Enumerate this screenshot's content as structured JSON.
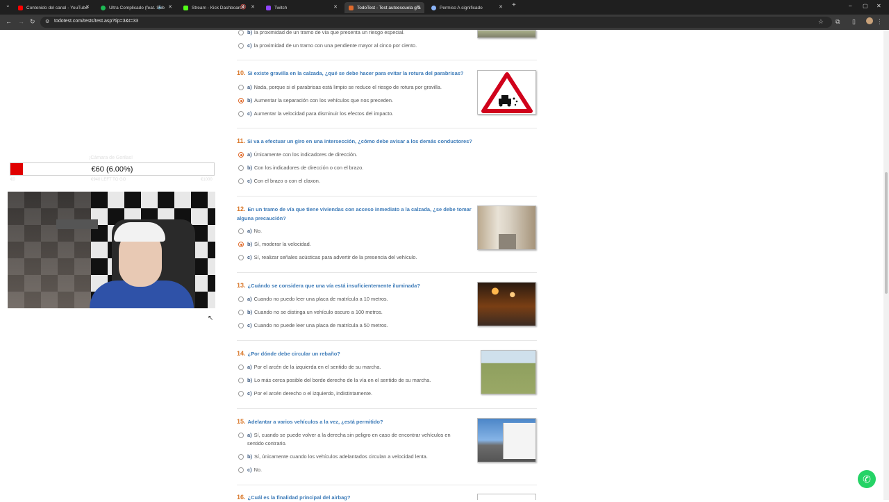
{
  "browser": {
    "tabs": [
      {
        "title": "Contenido del canal - YouTube",
        "color": "#ff0000",
        "active": false
      },
      {
        "title": "Ultra Complicado (feat. Seb",
        "color": "#1db954",
        "active": false
      },
      {
        "title": "Stream - Kick Dashboard",
        "color": "#53fc18",
        "active": false
      },
      {
        "title": "Twitch",
        "color": "#9146ff",
        "active": false
      },
      {
        "title": "TodoTest - Test autoescuela gra",
        "color": "#e06a2b",
        "active": true
      },
      {
        "title": "Permiso A significado",
        "color": "#8ab4f8",
        "active": false
      }
    ],
    "url": "todotest.com/tests/test.asp?tip=3&t=33"
  },
  "overlay": {
    "goal_label": "¡Cámara de Gorilas!",
    "goal_text": "€60 (6.00%)",
    "goal_progress": 0.06,
    "goal_min": "€0",
    "goal_togo": "€940 LEFT TO GO",
    "goal_max": "€1000"
  },
  "questions": [
    {
      "number": "",
      "title": "",
      "options": [
        {
          "letter": "b)",
          "text": "la proximidad de un tramo de vía que presenta un riesgo especial.",
          "selected": false
        },
        {
          "letter": "c)",
          "text": "la proximidad de un tramo con una pendiente mayor al cinco por ciento.",
          "selected": false
        }
      ]
    },
    {
      "number": "10.",
      "title": "Si existe gravilla en la calzada, ¿qué se debe hacer para evitar la rotura del parabrisas?",
      "options": [
        {
          "letter": "a)",
          "text": "Nada, porque si el parabrisas está limpio se reduce el riesgo de rotura por gravilla.",
          "selected": false
        },
        {
          "letter": "b)",
          "text": "Aumentar la separación con los vehículos que nos preceden.",
          "selected": true
        },
        {
          "letter": "c)",
          "text": "Aumentar la velocidad para disminuir los efectos del impacto.",
          "selected": false
        }
      ]
    },
    {
      "number": "11.",
      "title": "Si va a efectuar un giro en una intersección, ¿cómo debe avisar a los demás conductores?",
      "options": [
        {
          "letter": "a)",
          "text": "Únicamente con los indicadores de dirección.",
          "selected": true
        },
        {
          "letter": "b)",
          "text": "Con los indicadores de dirección o con el brazo.",
          "selected": false
        },
        {
          "letter": "c)",
          "text": "Con el brazo o con el claxon.",
          "selected": false
        }
      ]
    },
    {
      "number": "12.",
      "title": "En un tramo de vía que tiene viviendas con acceso inmediato a la calzada, ¿se debe tomar alguna precaución?",
      "options": [
        {
          "letter": "a)",
          "text": "No.",
          "selected": false
        },
        {
          "letter": "b)",
          "text": "Sí, moderar la velocidad.",
          "selected": true
        },
        {
          "letter": "c)",
          "text": "Sí, realizar señales acústicas para advertir de la presencia del vehículo.",
          "selected": false
        }
      ]
    },
    {
      "number": "13.",
      "title": "¿Cuándo se considera que una vía está insuficientemente iluminada?",
      "options": [
        {
          "letter": "a)",
          "text": "Cuando no puedo leer una placa de matrícula a 10 metros.",
          "selected": false
        },
        {
          "letter": "b)",
          "text": "Cuando no se distinga un vehículo oscuro a 100 metros.",
          "selected": false
        },
        {
          "letter": "c)",
          "text": "Cuando no puede leer una placa de matrícula a 50 metros.",
          "selected": false
        }
      ]
    },
    {
      "number": "14.",
      "title": "¿Por dónde debe circular un rebaño?",
      "options": [
        {
          "letter": "a)",
          "text": "Por el arcén de la izquierda en el sentido de su marcha.",
          "selected": false
        },
        {
          "letter": "b)",
          "text": "Lo más cerca posible del borde derecho de la vía en el sentido de su marcha.",
          "selected": false
        },
        {
          "letter": "c)",
          "text": "Por el arcén derecho o el izquierdo, indistintamente.",
          "selected": false
        }
      ]
    },
    {
      "number": "15.",
      "title": "Adelantar a varios vehículos a la vez, ¿está permitido?",
      "options": [
        {
          "letter": "a)",
          "text": "Sí, cuando se puede volver a la derecha sin peligro en caso de encontrar vehículos en sentido contrario.",
          "selected": false
        },
        {
          "letter": "b)",
          "text": "Sí, únicamente cuando los vehículos adelantados circulan a velocidad lenta.",
          "selected": false
        },
        {
          "letter": "c)",
          "text": "No.",
          "selected": false
        }
      ]
    },
    {
      "number": "16.",
      "title": "¿Cuál es la finalidad principal del airbag?",
      "options": []
    }
  ]
}
